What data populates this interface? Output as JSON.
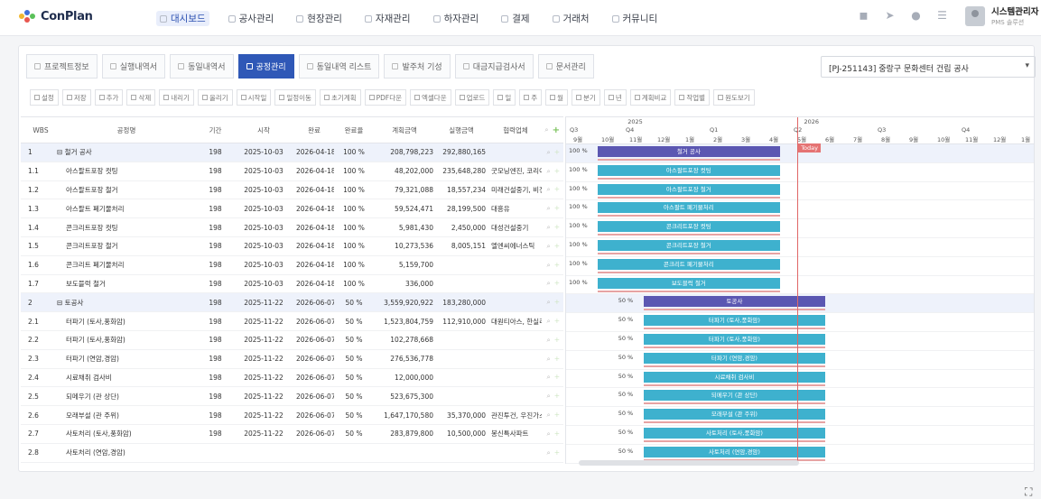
{
  "app": {
    "name": "ConPlan"
  },
  "nav": [
    {
      "label": "대시보드",
      "active": true
    },
    {
      "label": "공사관리"
    },
    {
      "label": "현장관리"
    },
    {
      "label": "자재관리"
    },
    {
      "label": "하자관리"
    },
    {
      "label": "결제"
    },
    {
      "label": "거래처"
    },
    {
      "label": "커뮤니티"
    }
  ],
  "user": {
    "name": "시스템관리자",
    "role": "PMS 솔루션"
  },
  "tabs": [
    {
      "label": "프로젝트정보"
    },
    {
      "label": "실행내역서"
    },
    {
      "label": "동일내역서"
    },
    {
      "label": "공정관리",
      "active": true
    },
    {
      "label": "동일내역 리스트"
    },
    {
      "label": "발주처 기성"
    },
    {
      "label": "대금지급검사서"
    },
    {
      "label": "문서관리"
    }
  ],
  "project": {
    "selected": "[PJ-251143] 중랑구 문화센터 건립 공사"
  },
  "toolbar": [
    "설정",
    "저장",
    "추가",
    "삭제",
    "내리기",
    "올리기",
    "시작일",
    "일정이동",
    "초기계획",
    "PDF다운",
    "엑셀다운",
    "업로드",
    "일",
    "주",
    "월",
    "분기",
    "년",
    "계획비교",
    "작업별",
    "원도보기"
  ],
  "grid": {
    "headers": {
      "wbs": "WBS",
      "name": "공정명",
      "dur": "기간",
      "start": "시작",
      "end": "완료",
      "pct": "완료율",
      "plan": "계획금액",
      "act": "실행금액",
      "co": "협력업체"
    },
    "rows": [
      {
        "wbs": "1",
        "name": "철거 공사",
        "dur": "198",
        "start": "2025-10-03",
        "end": "2026-04-18",
        "pct": "100 %",
        "plan": "208,798,223",
        "act": "292,880,165",
        "co": "",
        "top": true
      },
      {
        "wbs": "1.1",
        "name": "아스팔트포장 컷팅",
        "dur": "198",
        "start": "2025-10-03",
        "end": "2026-04-18",
        "pct": "100 %",
        "plan": "48,202,000",
        "act": "235,648,280",
        "co": "굿모닝엔진, 코리아"
      },
      {
        "wbs": "1.2",
        "name": "아스팔트포장 철거",
        "dur": "198",
        "start": "2025-10-03",
        "end": "2026-04-18",
        "pct": "100 %",
        "plan": "79,321,088",
        "act": "18,557,234",
        "co": "미래건설중기, 비전"
      },
      {
        "wbs": "1.3",
        "name": "아스팔트 폐기물처리",
        "dur": "198",
        "start": "2025-10-03",
        "end": "2026-04-18",
        "pct": "100 %",
        "plan": "59,524,471",
        "act": "28,199,500",
        "co": "대흥유"
      },
      {
        "wbs": "1.4",
        "name": "콘크리트포장 컷팅",
        "dur": "198",
        "start": "2025-10-03",
        "end": "2026-04-18",
        "pct": "100 %",
        "plan": "5,981,430",
        "act": "2,450,000",
        "co": "대성건설중기"
      },
      {
        "wbs": "1.5",
        "name": "콘크리트포장 철거",
        "dur": "198",
        "start": "2025-10-03",
        "end": "2026-04-18",
        "pct": "100 %",
        "plan": "10,273,536",
        "act": "8,005,151",
        "co": "엘엔씨에너스틱"
      },
      {
        "wbs": "1.6",
        "name": "콘크리트 폐기물처리",
        "dur": "198",
        "start": "2025-10-03",
        "end": "2026-04-18",
        "pct": "100 %",
        "plan": "5,159,700",
        "act": "",
        "co": ""
      },
      {
        "wbs": "1.7",
        "name": "보도블럭 철거",
        "dur": "198",
        "start": "2025-10-03",
        "end": "2026-04-18",
        "pct": "100 %",
        "plan": "336,000",
        "act": "",
        "co": ""
      },
      {
        "wbs": "2",
        "name": "토공사",
        "dur": "198",
        "start": "2025-11-22",
        "end": "2026-06-07",
        "pct": "50 %",
        "plan": "3,559,920,922",
        "act": "183,280,000",
        "co": "",
        "top": true
      },
      {
        "wbs": "2.1",
        "name": "터파기 (토사,풍화암)",
        "dur": "198",
        "start": "2025-11-22",
        "end": "2026-06-07",
        "pct": "50 %",
        "plan": "1,523,804,759",
        "act": "112,910,000",
        "co": "대원티아스, 한실리"
      },
      {
        "wbs": "2.2",
        "name": "터파기 (토사,풍화암)",
        "dur": "198",
        "start": "2025-11-22",
        "end": "2026-06-07",
        "pct": "50 %",
        "plan": "102,278,668",
        "act": "",
        "co": ""
      },
      {
        "wbs": "2.3",
        "name": "터파기 (연암,경암)",
        "dur": "198",
        "start": "2025-11-22",
        "end": "2026-06-07",
        "pct": "50 %",
        "plan": "276,536,778",
        "act": "",
        "co": ""
      },
      {
        "wbs": "2.4",
        "name": "시료채취 검사비",
        "dur": "198",
        "start": "2025-11-22",
        "end": "2026-06-07",
        "pct": "50 %",
        "plan": "12,000,000",
        "act": "",
        "co": ""
      },
      {
        "wbs": "2.5",
        "name": "되메우기 (관 상단)",
        "dur": "198",
        "start": "2025-11-22",
        "end": "2026-06-07",
        "pct": "50 %",
        "plan": "523,675,300",
        "act": "",
        "co": ""
      },
      {
        "wbs": "2.6",
        "name": "모래부설 (관 주위)",
        "dur": "198",
        "start": "2025-11-22",
        "end": "2026-06-07",
        "pct": "50 %",
        "plan": "1,647,170,580",
        "act": "35,370,000",
        "co": "관진투건, 우진가스"
      },
      {
        "wbs": "2.7",
        "name": "사토처리 (토사,풍화암)",
        "dur": "198",
        "start": "2025-11-22",
        "end": "2026-06-07",
        "pct": "50 %",
        "plan": "283,879,800",
        "act": "10,500,000",
        "co": "봉신특사파트"
      },
      {
        "wbs": "2.8",
        "name": "사토처리 (연암,경암)",
        "dur": "",
        "start": "",
        "end": "",
        "pct": "",
        "plan": "",
        "act": "",
        "co": ""
      }
    ]
  },
  "gantt": {
    "years": [
      {
        "label": "2025",
        "q": 0
      },
      {
        "label": "2026",
        "q": 2.5
      }
    ],
    "quarters": [
      "Q3",
      "Q4",
      "Q1",
      "Q2",
      "Q3",
      "Q4"
    ],
    "months": [
      "9월",
      "10월",
      "11월",
      "12월",
      "1월",
      "2월",
      "3월",
      "4월",
      "5월",
      "6월",
      "7월",
      "8월",
      "9월",
      "10월",
      "11월",
      "12월",
      "1월"
    ],
    "start_month": "2025-09",
    "today": "2026-05-07",
    "today_label": "Today",
    "bars": [
      {
        "label": "철거 공사",
        "pct": "100 %",
        "start": "2025-10-03",
        "end": "2026-04-18",
        "type": "sum"
      },
      {
        "label": "아스팔트포장 컷팅",
        "pct": "100 %",
        "start": "2025-10-03",
        "end": "2026-04-18",
        "type": "task"
      },
      {
        "label": "아스팔트포장 철거",
        "pct": "100 %",
        "start": "2025-10-03",
        "end": "2026-04-18",
        "type": "task"
      },
      {
        "label": "아스팔트 폐기물처리",
        "pct": "100 %",
        "start": "2025-10-03",
        "end": "2026-04-18",
        "type": "task"
      },
      {
        "label": "콘크리트포장 컷팅",
        "pct": "100 %",
        "start": "2025-10-03",
        "end": "2026-04-18",
        "type": "task"
      },
      {
        "label": "콘크리트포장 철거",
        "pct": "100 %",
        "start": "2025-10-03",
        "end": "2026-04-18",
        "type": "task"
      },
      {
        "label": "콘크리트 폐기물처리",
        "pct": "100 %",
        "start": "2025-10-03",
        "end": "2026-04-18",
        "type": "task"
      },
      {
        "label": "보도블럭 철거",
        "pct": "100 %",
        "start": "2025-10-03",
        "end": "2026-04-18",
        "type": "task"
      },
      {
        "label": "토공사",
        "pct": "50 %",
        "start": "2025-11-22",
        "end": "2026-06-07",
        "type": "sum"
      },
      {
        "label": "터파기 (토사,풍화암)",
        "pct": "50 %",
        "start": "2025-11-22",
        "end": "2026-06-07",
        "type": "task"
      },
      {
        "label": "터파기 (토사,풍화암)",
        "pct": "50 %",
        "start": "2025-11-22",
        "end": "2026-06-07",
        "type": "task"
      },
      {
        "label": "터파기 (연암,경암)",
        "pct": "50 %",
        "start": "2025-11-22",
        "end": "2026-06-07",
        "type": "task"
      },
      {
        "label": "시료채취 검사비",
        "pct": "50 %",
        "start": "2025-11-22",
        "end": "2026-06-07",
        "type": "task"
      },
      {
        "label": "되메우기 (관 상단)",
        "pct": "50 %",
        "start": "2025-11-22",
        "end": "2026-06-07",
        "type": "task"
      },
      {
        "label": "모래부설 (관 주위)",
        "pct": "50 %",
        "start": "2025-11-22",
        "end": "2026-06-07",
        "type": "task"
      },
      {
        "label": "사토처리 (토사,풍화암)",
        "pct": "50 %",
        "start": "2025-11-22",
        "end": "2026-06-07",
        "type": "task"
      },
      {
        "label": "사토처리 (연암,경암)",
        "pct": "50 %",
        "start": "2025-11-22",
        "end": "2026-06-07",
        "type": "task"
      }
    ]
  },
  "colors": {
    "primary": "#2f58b7",
    "summary_bar": "#5b57b2",
    "task_bar": "#3eb1ce",
    "today": "#e06666"
  }
}
